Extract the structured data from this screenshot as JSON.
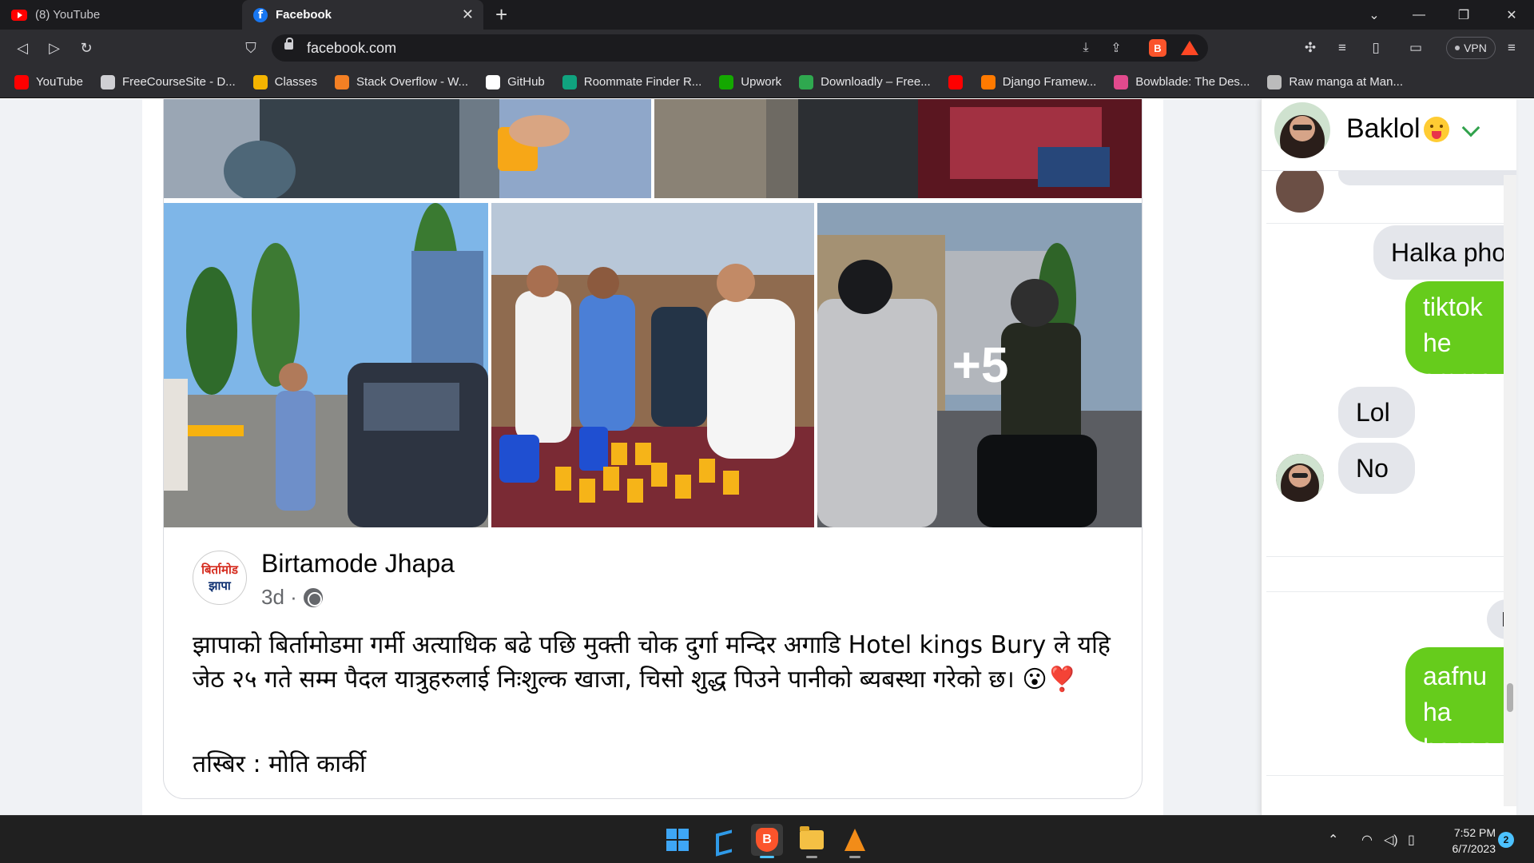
{
  "browser": {
    "tabs": [
      {
        "title": "(8) YouTube",
        "icon": "youtube-icon",
        "active": false
      },
      {
        "title": "Facebook",
        "icon": "facebook-icon",
        "active": true
      }
    ],
    "new_tab_label": "+",
    "address": "facebook.com",
    "vpn_label": "VPN"
  },
  "bookmarks": [
    {
      "label": "YouTube",
      "icon": "youtube-icon",
      "color": "#ff0000"
    },
    {
      "label": "FreeCourseSite - D...",
      "icon": "globe-icon",
      "color": "#cfcfd3"
    },
    {
      "label": "Classes",
      "icon": "classroom-icon",
      "color": "#f4b400"
    },
    {
      "label": "Stack Overflow - W...",
      "icon": "stackoverflow-icon",
      "color": "#f48024"
    },
    {
      "label": "GitHub",
      "icon": "github-icon",
      "color": "#ffffff"
    },
    {
      "label": "Roommate Finder R...",
      "icon": "openai-icon",
      "color": "#10a37f"
    },
    {
      "label": "Upwork",
      "icon": "upwork-icon",
      "color": "#14a800"
    },
    {
      "label": "Downloadly – Free...",
      "icon": "downloadly-icon",
      "color": "#2fa84f"
    },
    {
      "label": "",
      "icon": "youtube-icon",
      "color": "#ff0000"
    },
    {
      "label": "Django Framew...",
      "icon": "fire-icon",
      "color": "#ff7a00"
    },
    {
      "label": "Bowblade: The Des...",
      "icon": "m-icon",
      "color": "#e24a8d"
    },
    {
      "label": "Raw manga at Man...",
      "icon": "manga-icon",
      "color": "#bbbbbb"
    }
  ],
  "post": {
    "more_photos_label": "+5",
    "page_name": "Birtamode Jhapa",
    "avatar_line1": "बिर्तामोड",
    "avatar_line2": "झापा",
    "time": "3d ·",
    "text": "झापाको बिर्तामोडमा गर्मी अत्याधिक बढे पछि मुक्ती चोक दुर्गा मन्दिर अगाडि Hotel kings Bury ले यहि जेठ २५ गते सम्म पैदल यात्रुहरुलाई निःशुल्क खाजा, चिसो शुद्ध पिउने पानीको ब्यबस्था गरेको छ। 😮❣️",
    "credit": "तस्बिर : मोति कार्की"
  },
  "chat": {
    "contact_name": "Baklol",
    "messages": [
      {
        "direction": "in",
        "text": "Halka phone"
      },
      {
        "direction": "out",
        "text": "tiktok he smma a"
      },
      {
        "direction": "in",
        "text": "Lol"
      },
      {
        "direction": "in",
        "text": "No"
      },
      {
        "direction": "in",
        "text": "K"
      },
      {
        "direction": "out",
        "text": "aafnu ha banaera"
      }
    ]
  },
  "taskbar": {
    "apps": [
      "windows-start",
      "vscode",
      "brave",
      "file-explorer",
      "vlc"
    ],
    "time": "7:52 PM",
    "date": "6/7/2023",
    "notifications": "2"
  },
  "colors": {
    "facebook_blue": "#1877f2",
    "chat_outgoing": "#66cc1c",
    "chat_incoming": "#e4e6eb",
    "browser_chrome": "#2d2d31"
  }
}
